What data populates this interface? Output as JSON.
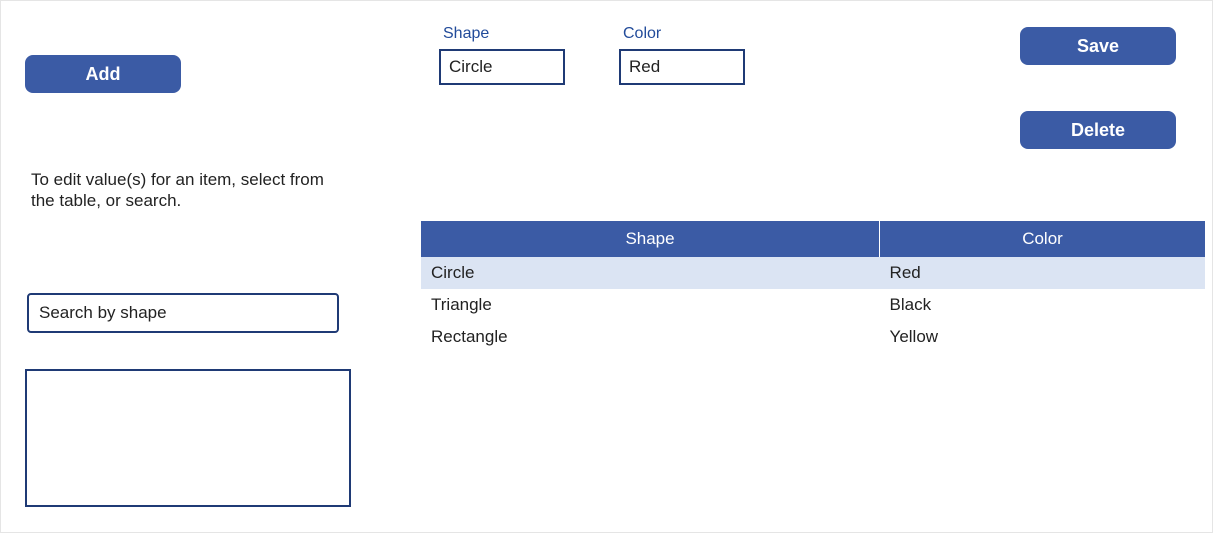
{
  "buttons": {
    "add": "Add",
    "save": "Save",
    "delete": "Delete"
  },
  "fields": {
    "shape": {
      "label": "Shape",
      "value": "Circle"
    },
    "color": {
      "label": "Color",
      "value": "Red"
    }
  },
  "instruction": "To edit value(s) for an item, select from the table, or search.",
  "search": {
    "placeholder": "Search by shape",
    "value": ""
  },
  "table": {
    "headers": {
      "shape": "Shape",
      "color": "Color"
    },
    "rows": [
      {
        "shape": "Circle",
        "color": "Red",
        "selected": true
      },
      {
        "shape": "Triangle",
        "color": "Black",
        "selected": false
      },
      {
        "shape": "Rectangle",
        "color": "Yellow",
        "selected": false
      }
    ]
  }
}
